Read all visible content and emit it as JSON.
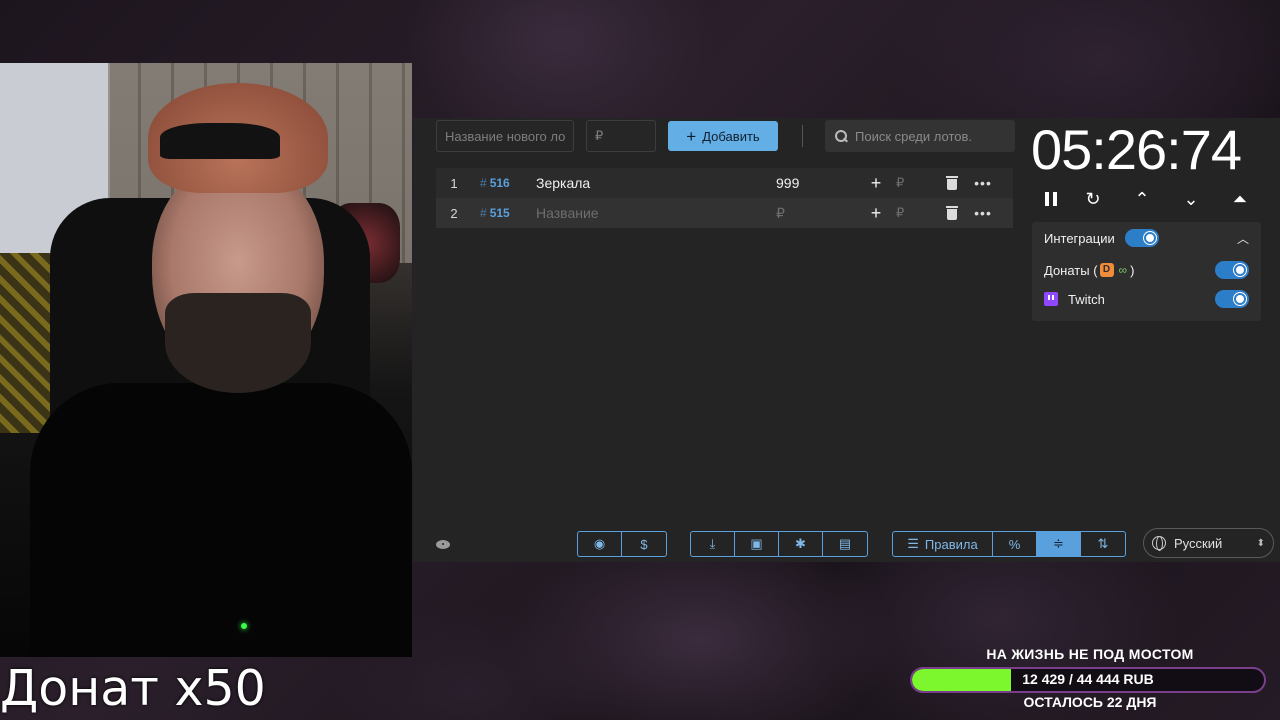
{
  "webcam": {
    "caption": "Донат x50"
  },
  "toolbar": {
    "name_placeholder": "Название нового ло",
    "price_placeholder": "₽",
    "add_label": "Добавить",
    "search_placeholder": "Поиск среди лотов."
  },
  "lots": [
    {
      "index": "1",
      "id": "516",
      "name": "Зеркала",
      "amount": "999",
      "add_placeholder": "₽"
    },
    {
      "index": "2",
      "id": "515",
      "name": "Название",
      "amount": "₽",
      "add_placeholder": "₽"
    }
  ],
  "bottom_bar": {
    "rules_label": "Правила",
    "percent_label": "%",
    "language": "Русский"
  },
  "timer": {
    "value": "05:26:74"
  },
  "integrations": {
    "title": "Интеграции",
    "donations_label": "Донаты (",
    "donations_close": ")",
    "twitch_label": "Twitch",
    "enabled": true
  },
  "goal": {
    "title": "НА ЖИЗНЬ НЕ ПОД МОСТОМ",
    "progress_text": "12 429 / 44 444 RUB",
    "current": 12429,
    "target": 44444,
    "fraction": 0.28,
    "remaining": "ОСТАЛОСЬ 22 ДНЯ",
    "fill_color": "#7cf72e"
  },
  "colors": {
    "accent": "#64aee6",
    "toggle": "#2d7ec9",
    "lot_id": "#5aa0dc"
  }
}
